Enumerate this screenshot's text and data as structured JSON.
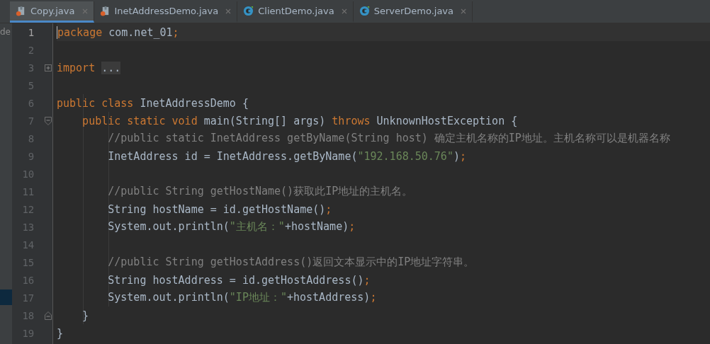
{
  "tabs": [
    {
      "label": "Copy.java",
      "kind": "file",
      "selected": true
    },
    {
      "label": "InetAddressDemo.java",
      "kind": "file",
      "selected": false
    },
    {
      "label": "ClientDemo.java",
      "kind": "class",
      "selected": false
    },
    {
      "label": "ServerDemo.java",
      "kind": "class",
      "selected": false
    }
  ],
  "project_panel": {
    "label": "de"
  },
  "lines": [
    {
      "number": "1",
      "current": true,
      "tokens": [
        {
          "kind": "keyword",
          "text": "package"
        },
        {
          "kind": "plain",
          "text": " com.net_01"
        },
        {
          "kind": "keyword",
          "text": ";"
        }
      ]
    },
    {
      "number": "2",
      "current": false
    },
    {
      "number": "3",
      "current": false,
      "fold": {
        "kind": "collapsed"
      },
      "tokens": [
        {
          "kind": "keyword",
          "text": "import"
        },
        {
          "kind": "folded",
          "text": "..."
        }
      ]
    },
    {
      "number": "5",
      "current": false
    },
    {
      "number": "6",
      "current": false,
      "tokens": [
        {
          "kind": "keyword",
          "text": "public class"
        },
        {
          "kind": "plain",
          "text": " InetAddressDemo {"
        }
      ]
    },
    {
      "number": "7",
      "current": false,
      "fold": {
        "kind": "open"
      },
      "tokens": [
        {
          "kind": "keyword",
          "text": "    public static void"
        },
        {
          "kind": "plain",
          "text": " main(String[] args) "
        },
        {
          "kind": "keyword",
          "text": "throws"
        },
        {
          "kind": "plain",
          "text": " UnknownHostException {"
        }
      ]
    },
    {
      "number": "8",
      "current": false,
      "tokens": [
        {
          "kind": "comment",
          "text": "        //public static InetAddress getByName(String host) 确定主机名称的IP地址。主机名称可以是机器名称"
        }
      ]
    },
    {
      "number": "9",
      "current": false,
      "tokens": [
        {
          "kind": "plain",
          "text": "        InetAddress id = InetAddress.getByName("
        },
        {
          "kind": "string",
          "text": "\"192.168.50.76\""
        },
        {
          "kind": "plain",
          "text": ")"
        },
        {
          "kind": "keyword",
          "text": ";"
        }
      ]
    },
    {
      "number": "10",
      "current": false
    },
    {
      "number": "11",
      "current": false,
      "tokens": [
        {
          "kind": "comment",
          "text": "        //public String getHostName()获取此IP地址的主机名。"
        }
      ]
    },
    {
      "number": "12",
      "current": false,
      "tokens": [
        {
          "kind": "plain",
          "text": "        String hostName = id.getHostName()"
        },
        {
          "kind": "keyword",
          "text": ";"
        }
      ]
    },
    {
      "number": "13",
      "current": false,
      "tokens": [
        {
          "kind": "plain",
          "text": "        System.out.println("
        },
        {
          "kind": "string",
          "text": "\"主机名：\""
        },
        {
          "kind": "plain",
          "text": "+hostName)"
        },
        {
          "kind": "keyword",
          "text": ";"
        }
      ]
    },
    {
      "number": "14",
      "current": false
    },
    {
      "number": "15",
      "current": false,
      "tokens": [
        {
          "kind": "comment",
          "text": "        //public String getHostAddress()返回文本显示中的IP地址字符串。"
        }
      ]
    },
    {
      "number": "16",
      "current": false,
      "tokens": [
        {
          "kind": "plain",
          "text": "        String hostAddress = id.getHostAddress()"
        },
        {
          "kind": "keyword",
          "text": ";"
        }
      ]
    },
    {
      "number": "17",
      "current": false,
      "tokens": [
        {
          "kind": "plain",
          "text": "        System.out.println("
        },
        {
          "kind": "string",
          "text": "\"IP地址：\""
        },
        {
          "kind": "plain",
          "text": "+hostAddress)"
        },
        {
          "kind": "keyword",
          "text": ";"
        }
      ]
    },
    {
      "number": "18",
      "current": false,
      "fold": {
        "kind": "end"
      },
      "tokens": [
        {
          "kind": "plain",
          "text": "    }"
        }
      ]
    },
    {
      "number": "19",
      "current": false,
      "tokens": [
        {
          "kind": "plain",
          "text": "}"
        }
      ]
    }
  ]
}
